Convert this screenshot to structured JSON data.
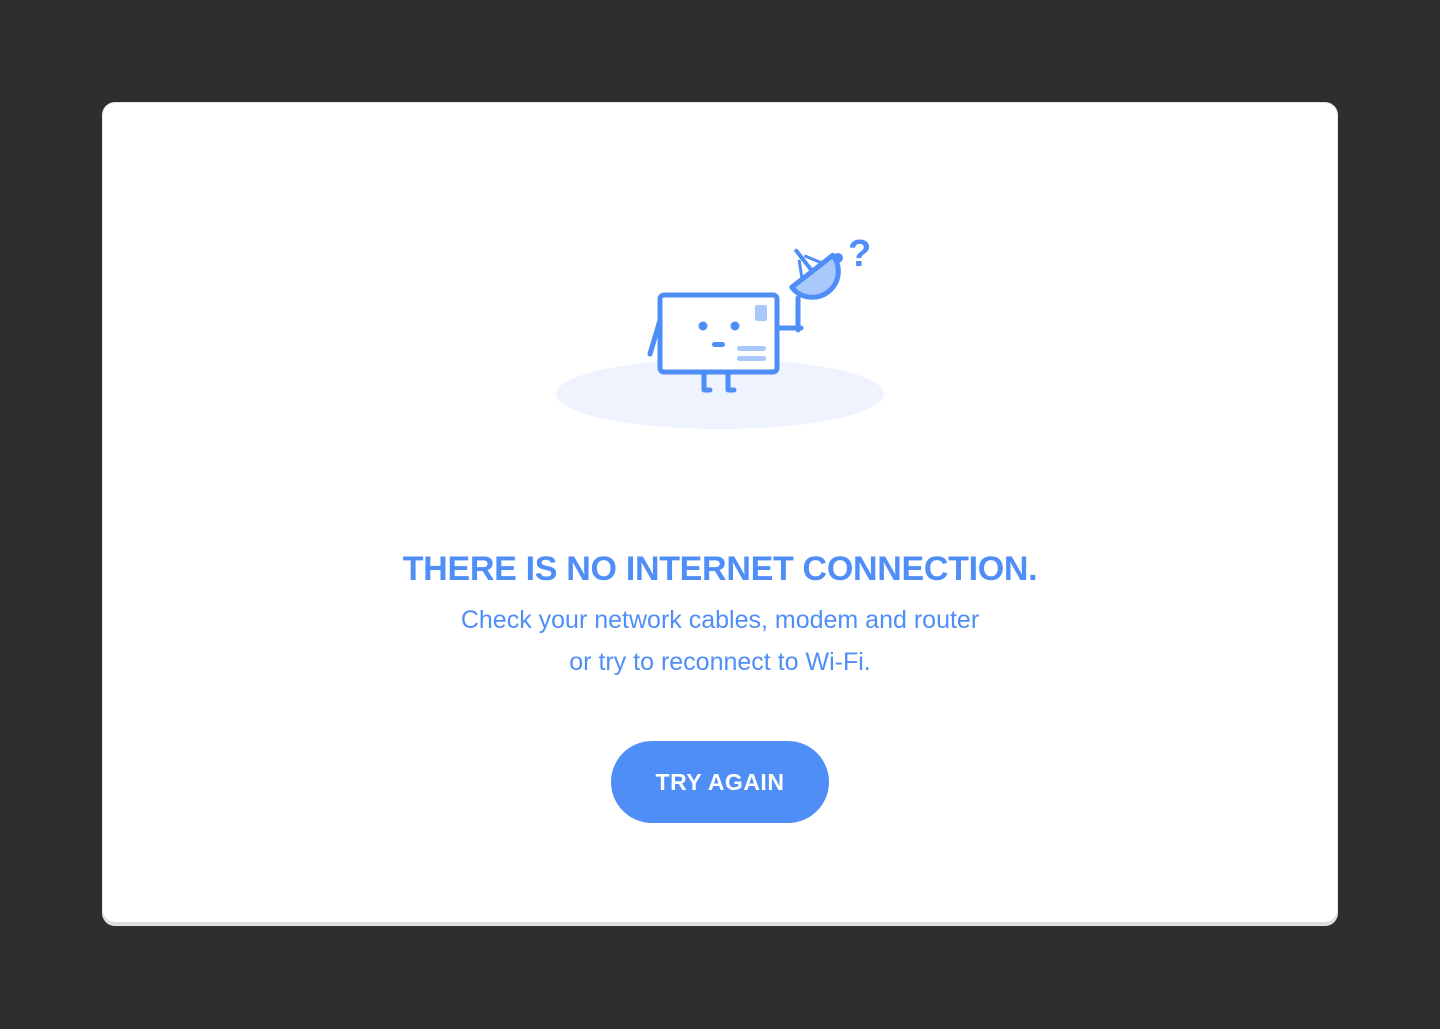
{
  "dialog": {
    "title": "THERE IS NO INTERNET CONNECTION.",
    "message_line1": "Check your network cables, modem and router",
    "message_line2": "or try to reconnect to Wi-Fi.",
    "retry_label": "TRY AGAIN",
    "illustration_icon": "offline-postcard-satellite-dish-icon",
    "question_mark": "?"
  },
  "colors": {
    "background": "#2e2e2e",
    "card": "#ffffff",
    "accent": "#4f8ef7",
    "accent_light": "#a9c8fb",
    "shadow": "#eef3fe"
  }
}
